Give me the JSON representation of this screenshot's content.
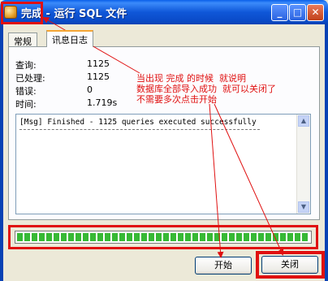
{
  "window": {
    "title_done": "完成",
    "title_rest": " - 运行 SQL 文件",
    "controls": {
      "minimize": "_",
      "maximize": "□",
      "close": "✕"
    }
  },
  "tabs": [
    {
      "label": "常规",
      "active": false
    },
    {
      "label": "讯息日志",
      "active": true
    }
  ],
  "stats": [
    {
      "label": "查询:",
      "value": "1125"
    },
    {
      "label": "已处理:",
      "value": "1125"
    },
    {
      "label": "错误:",
      "value": "0"
    },
    {
      "label": "时间:",
      "value": "1.719s"
    }
  ],
  "log": {
    "line": "[Msg] Finished - 1125 queries executed successfully"
  },
  "progress": {
    "fraction": 1.0,
    "color": "#37b935"
  },
  "buttons": {
    "start": "开始",
    "close": "关闭"
  },
  "annotation": {
    "lines": [
      "当出现 完成 的时候  就说明",
      "数据库全部导入成功  就可以关闭了",
      "不需要多次点击开始"
    ],
    "color": "#e01010"
  }
}
